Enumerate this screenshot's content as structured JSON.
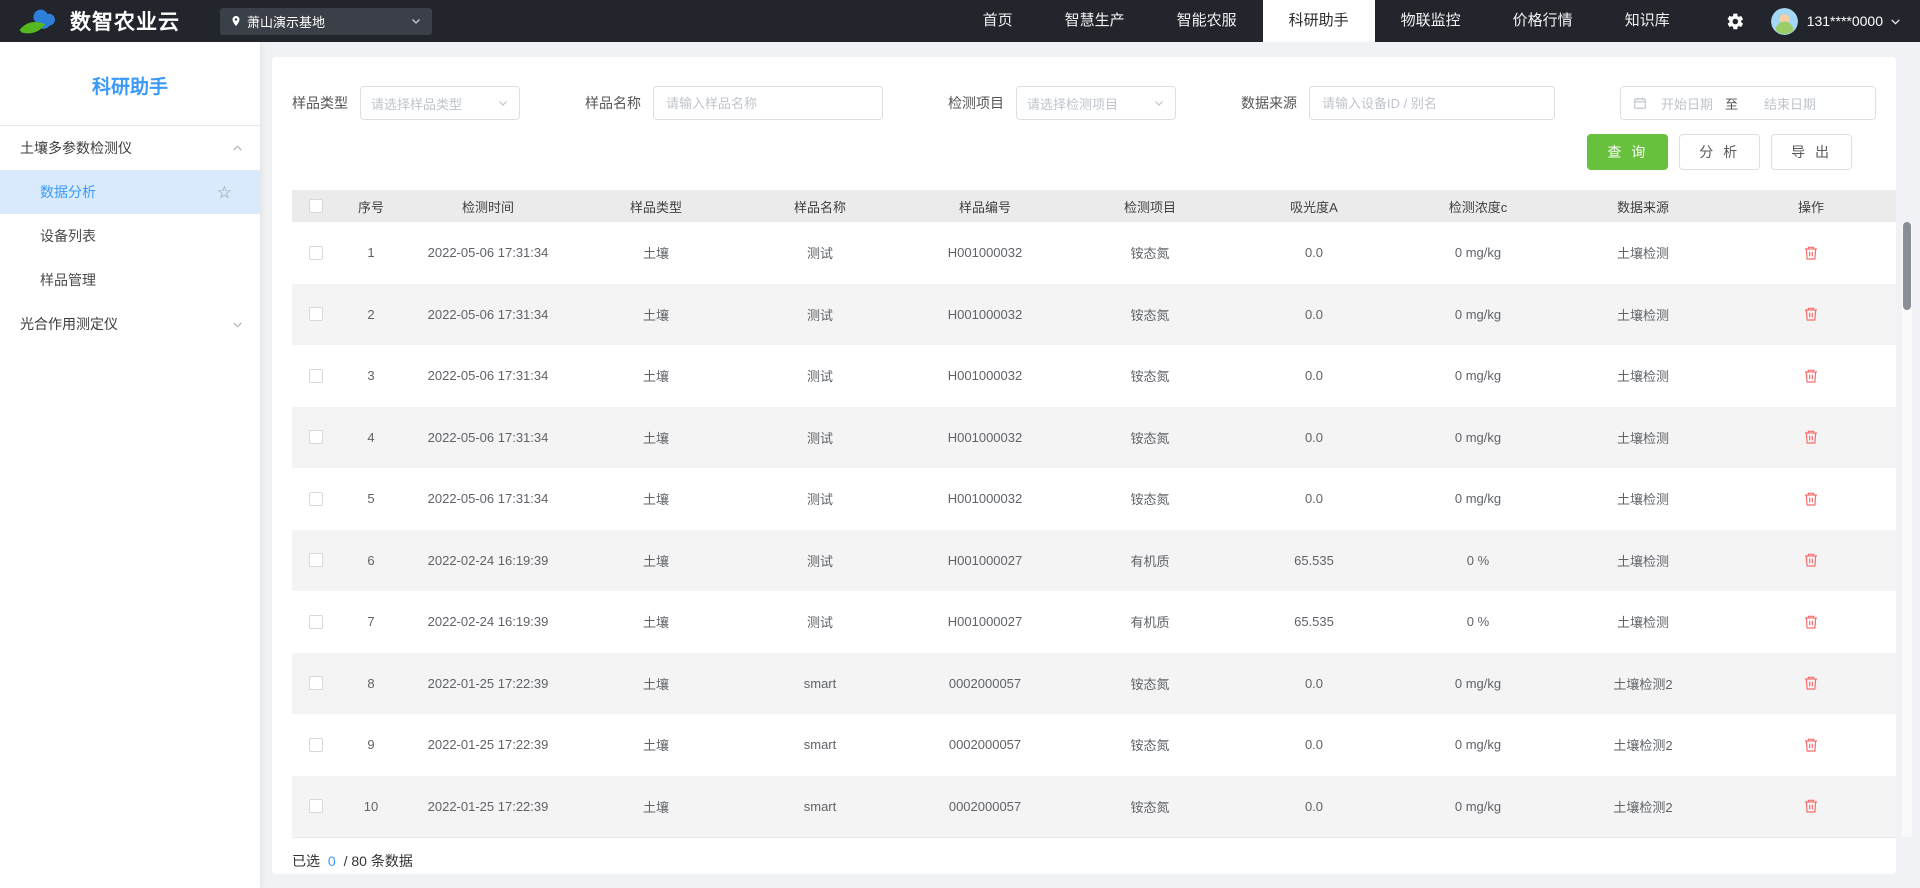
{
  "navbar": {
    "title": "数智农业云",
    "base_selector": "萧山演示基地",
    "menu": [
      {
        "name": "home",
        "label": "首页",
        "active": false
      },
      {
        "name": "smart-production",
        "label": "智慧生产",
        "active": false
      },
      {
        "name": "smart-service",
        "label": "智能农服",
        "active": false
      },
      {
        "name": "research-assistant",
        "label": "科研助手",
        "active": true
      },
      {
        "name": "iot-monitor",
        "label": "物联监控",
        "active": false
      },
      {
        "name": "price-info",
        "label": "价格行情",
        "active": false
      },
      {
        "name": "knowledge-base",
        "label": "知识库",
        "active": false
      }
    ],
    "user": "131****0000"
  },
  "sidebar": {
    "title": "科研助手",
    "groups": [
      {
        "label": "土壤多参数检测仪",
        "expanded": true,
        "children": [
          {
            "label": "数据分析",
            "active": true,
            "starred": true
          },
          {
            "label": "设备列表",
            "active": false
          },
          {
            "label": "样品管理",
            "active": false
          }
        ]
      },
      {
        "label": "光合作用测定仪",
        "expanded": false,
        "children": []
      }
    ]
  },
  "filters": {
    "sample_type": {
      "label": "样品类型",
      "placeholder": "请选择样品类型"
    },
    "sample_name": {
      "label": "样品名称",
      "placeholder": "请输入样品名称"
    },
    "test_item": {
      "label": "检测项目",
      "placeholder": "请选择检测项目"
    },
    "data_source": {
      "label": "数据来源",
      "placeholder": "请输入设备ID / 别名"
    },
    "date_range": {
      "start_placeholder": "开始日期",
      "separator": "至",
      "end_placeholder": "结束日期"
    },
    "buttons": {
      "query": "查 询",
      "analyze": "分 析",
      "export": "导 出"
    }
  },
  "table": {
    "columns": [
      "序号",
      "检测时间",
      "样品类型",
      "样品名称",
      "样品编号",
      "检测项目",
      "吸光度A",
      "检测浓度c",
      "数据来源",
      "操作"
    ],
    "cell_names": [
      "index",
      "detect-time",
      "sample-type",
      "sample-name",
      "sample-code",
      "test-item",
      "absorbance",
      "concentration",
      "data-source"
    ],
    "rows": [
      [
        "1",
        "2022-05-06 17:31:34",
        "土壤",
        "测试",
        "H001000032",
        "铵态氮",
        "0.0",
        "0 mg/kg",
        "土壤检测"
      ],
      [
        "2",
        "2022-05-06 17:31:34",
        "土壤",
        "测试",
        "H001000032",
        "铵态氮",
        "0.0",
        "0 mg/kg",
        "土壤检测"
      ],
      [
        "3",
        "2022-05-06 17:31:34",
        "土壤",
        "测试",
        "H001000032",
        "铵态氮",
        "0.0",
        "0 mg/kg",
        "土壤检测"
      ],
      [
        "4",
        "2022-05-06 17:31:34",
        "土壤",
        "测试",
        "H001000032",
        "铵态氮",
        "0.0",
        "0 mg/kg",
        "土壤检测"
      ],
      [
        "5",
        "2022-05-06 17:31:34",
        "土壤",
        "测试",
        "H001000032",
        "铵态氮",
        "0.0",
        "0 mg/kg",
        "土壤检测"
      ],
      [
        "6",
        "2022-02-24 16:19:39",
        "土壤",
        "测试",
        "H001000027",
        "有机质",
        "65.535",
        "0 %",
        "土壤检测"
      ],
      [
        "7",
        "2022-02-24 16:19:39",
        "土壤",
        "测试",
        "H001000027",
        "有机质",
        "65.535",
        "0 %",
        "土壤检测"
      ],
      [
        "8",
        "2022-01-25 17:22:39",
        "土壤",
        "smart",
        "0002000057",
        "铵态氮",
        "0.0",
        "0 mg/kg",
        "土壤检测2"
      ],
      [
        "9",
        "2022-01-25 17:22:39",
        "土壤",
        "smart",
        "0002000057",
        "铵态氮",
        "0.0",
        "0 mg/kg",
        "土壤检测2"
      ],
      [
        "10",
        "2022-01-25 17:22:39",
        "土壤",
        "smart",
        "0002000057",
        "铵态氮",
        "0.0",
        "0 mg/kg",
        "土壤检测2"
      ]
    ]
  },
  "footer": {
    "prefix": "已选",
    "selected_count": "0",
    "suffix": "/ 80 条数据"
  },
  "icons": {
    "logo": "cloud-leaf-logo",
    "location": "location-pin-icon",
    "settings": "gear-icon",
    "star": "star-icon",
    "calendar": "calendar-icon",
    "delete": "trash-icon",
    "chevron_up": "chevron-up-icon",
    "chevron_down": "chevron-down-icon"
  },
  "colors": {
    "navbar_bg": "#22252c",
    "accent_blue": "#3b9af9",
    "active_menu_bg": "#d8eafc",
    "primary_green": "#68c13c",
    "danger_red": "#f56c6c",
    "table_header_bg": "#ebebeb",
    "stripe_bg": "#f4f4f5",
    "page_bg": "#f0f2f5"
  }
}
